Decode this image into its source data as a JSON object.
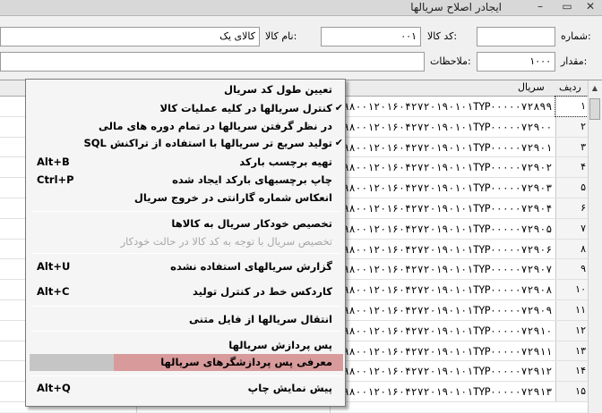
{
  "window": {
    "title": "ایجادر اصلاح سریالها",
    "min": "–",
    "max": "▭",
    "close": "✕"
  },
  "form": {
    "number_label": ":شماره",
    "number_value": "",
    "product_code_label": ":کد کالا",
    "product_code_value": "۰۰۱",
    "product_name_label": ":نام کالا",
    "product_name_value": "کالای یک",
    "quantity_label": ":مقدار",
    "quantity_value": "۱۰۰۰",
    "notes_label": ":ملاحظات",
    "notes_value": ""
  },
  "grid": {
    "headers": {
      "index": "ردیف",
      "serial": "سریال"
    },
    "rows": [
      {
        "index": "۱",
        "serial": "VU۹۸۰۰۱۲۰۱۶۰۴۲۷۲۰۱۹۰۱۰۱TYP۰۰۰۰۰۷۲۸۹۹"
      },
      {
        "index": "۲",
        "serial": "VU۹۸۰۰۱۲۰۱۶۰۴۲۷۲۰۱۹۰۱۰۱TYP۰۰۰۰۰۷۲۹۰۰"
      },
      {
        "index": "۳",
        "serial": "VU۹۸۰۰۱۲۰۱۶۰۴۲۷۲۰۱۹۰۱۰۱TYP۰۰۰۰۰۷۲۹۰۱"
      },
      {
        "index": "۴",
        "serial": "VU۹۸۰۰۱۲۰۱۶۰۴۲۷۲۰۱۹۰۱۰۱TYP۰۰۰۰۰۷۲۹۰۲"
      },
      {
        "index": "۵",
        "serial": "VU۹۸۰۰۱۲۰۱۶۰۴۲۷۲۰۱۹۰۱۰۱TYP۰۰۰۰۰۷۲۹۰۳"
      },
      {
        "index": "۶",
        "serial": "VU۹۸۰۰۱۲۰۱۶۰۴۲۷۲۰۱۹۰۱۰۱TYP۰۰۰۰۰۷۲۹۰۴"
      },
      {
        "index": "۷",
        "serial": "VU۹۸۰۰۱۲۰۱۶۰۴۲۷۲۰۱۹۰۱۰۱TYP۰۰۰۰۰۷۲۹۰۵"
      },
      {
        "index": "۸",
        "serial": "VU۹۸۰۰۱۲۰۱۶۰۴۲۷۲۰۱۹۰۱۰۱TYP۰۰۰۰۰۷۲۹۰۶"
      },
      {
        "index": "۹",
        "serial": "VU۹۸۰۰۱۲۰۱۶۰۴۲۷۲۰۱۹۰۱۰۱TYP۰۰۰۰۰۷۲۹۰۷"
      },
      {
        "index": "۱۰",
        "serial": "VU۹۸۰۰۱۲۰۱۶۰۴۲۷۲۰۱۹۰۱۰۱TYP۰۰۰۰۰۷۲۹۰۸"
      },
      {
        "index": "۱۱",
        "serial": "VU۹۸۰۰۱۲۰۱۶۰۴۲۷۲۰۱۹۰۱۰۱TYP۰۰۰۰۰۷۲۹۰۹"
      },
      {
        "index": "۱۲",
        "serial": "VU۹۸۰۰۱۲۰۱۶۰۴۲۷۲۰۱۹۰۱۰۱TYP۰۰۰۰۰۷۲۹۱۰"
      },
      {
        "index": "۱۳",
        "serial": "VU۹۸۰۰۱۲۰۱۶۰۴۲۷۲۰۱۹۰۱۰۱TYP۰۰۰۰۰۷۲۹۱۱"
      },
      {
        "index": "۱۴",
        "serial": "VU۹۸۰۰۱۲۰۱۶۰۴۲۷۲۰۱۹۰۱۰۱TYP۰۰۰۰۰۷۲۹۱۲"
      },
      {
        "index": "۱۵",
        "serial": "VU۹۸۰۰۱۲۰۱۶۰۴۲۷۲۰۱۹۰۱۰۱TYP۰۰۰۰۰۷۲۹۱۳"
      }
    ]
  },
  "menu": {
    "items": [
      {
        "label": "تعیین طول کد سریال",
        "shortcut": "",
        "check": ""
      },
      {
        "label": "کنترل سریالها در کلیه عملیات کالا",
        "shortcut": "",
        "check": "✔"
      },
      {
        "label": "در نظر گرفتن سریالها در تمام دوره های مالی",
        "shortcut": "",
        "check": ""
      },
      {
        "label": "تولید سریع تر سریالها با استفاده از تراکنش SQL",
        "shortcut": "",
        "check": "✔"
      },
      {
        "label": "تهیه برچسب بارکد",
        "shortcut": "Alt+B",
        "check": ""
      },
      {
        "label": "چاپ برچسبهای بارکد ایجاد شده",
        "shortcut": "Ctrl+P",
        "check": ""
      },
      {
        "label": "انعکاس شماره گارانتی در خروج سریال",
        "shortcut": "",
        "check": ""
      },
      {
        "label": "تخصیص خودکار سریال به کالاها",
        "shortcut": "",
        "check": ""
      },
      {
        "label": "تخصیص سریال با توجه به کد کالا در حالت خودکار",
        "shortcut": "",
        "check": ""
      },
      {
        "label": "گزارش سریالهای استفاده نشده",
        "shortcut": "Alt+U",
        "check": ""
      },
      {
        "label": "کاردکس خط در کنترل تولید",
        "shortcut": "Alt+C",
        "check": ""
      },
      {
        "label": "انتقال سریالها از فایل متنی",
        "shortcut": "",
        "check": ""
      },
      {
        "label": "پس پردازش سریالها",
        "shortcut": "",
        "check": ""
      },
      {
        "label": "معرفی پس پردازشگرهای سریالها",
        "shortcut": "",
        "check": ""
      },
      {
        "label": "پیش نمایش چاپ",
        "shortcut": "Alt+Q",
        "check": ""
      }
    ]
  },
  "colors": {
    "highlight_main": "#d89a9a",
    "highlight_left": "#c5c5c5",
    "disabled_text": "#a7a7a7"
  }
}
